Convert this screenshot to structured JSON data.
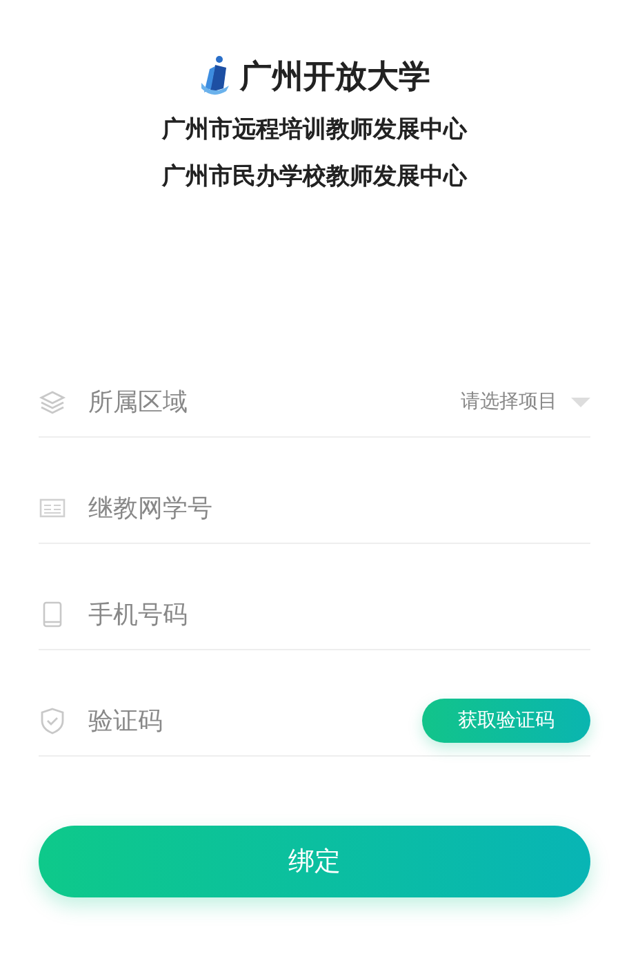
{
  "header": {
    "title": "广州开放大学",
    "subtitles": [
      "广州市远程培训教师发展中心",
      "广州市民办学校教师发展中心"
    ]
  },
  "fields": [
    {
      "kind": "select",
      "placeholder": "所属区域",
      "value_hint": "请选择项目"
    },
    {
      "kind": "text",
      "placeholder": "继教网学号"
    },
    {
      "kind": "phone",
      "placeholder": "手机号码"
    },
    {
      "kind": "code",
      "placeholder": "验证码",
      "action": "获取验证码"
    }
  ],
  "submit": "绑定"
}
